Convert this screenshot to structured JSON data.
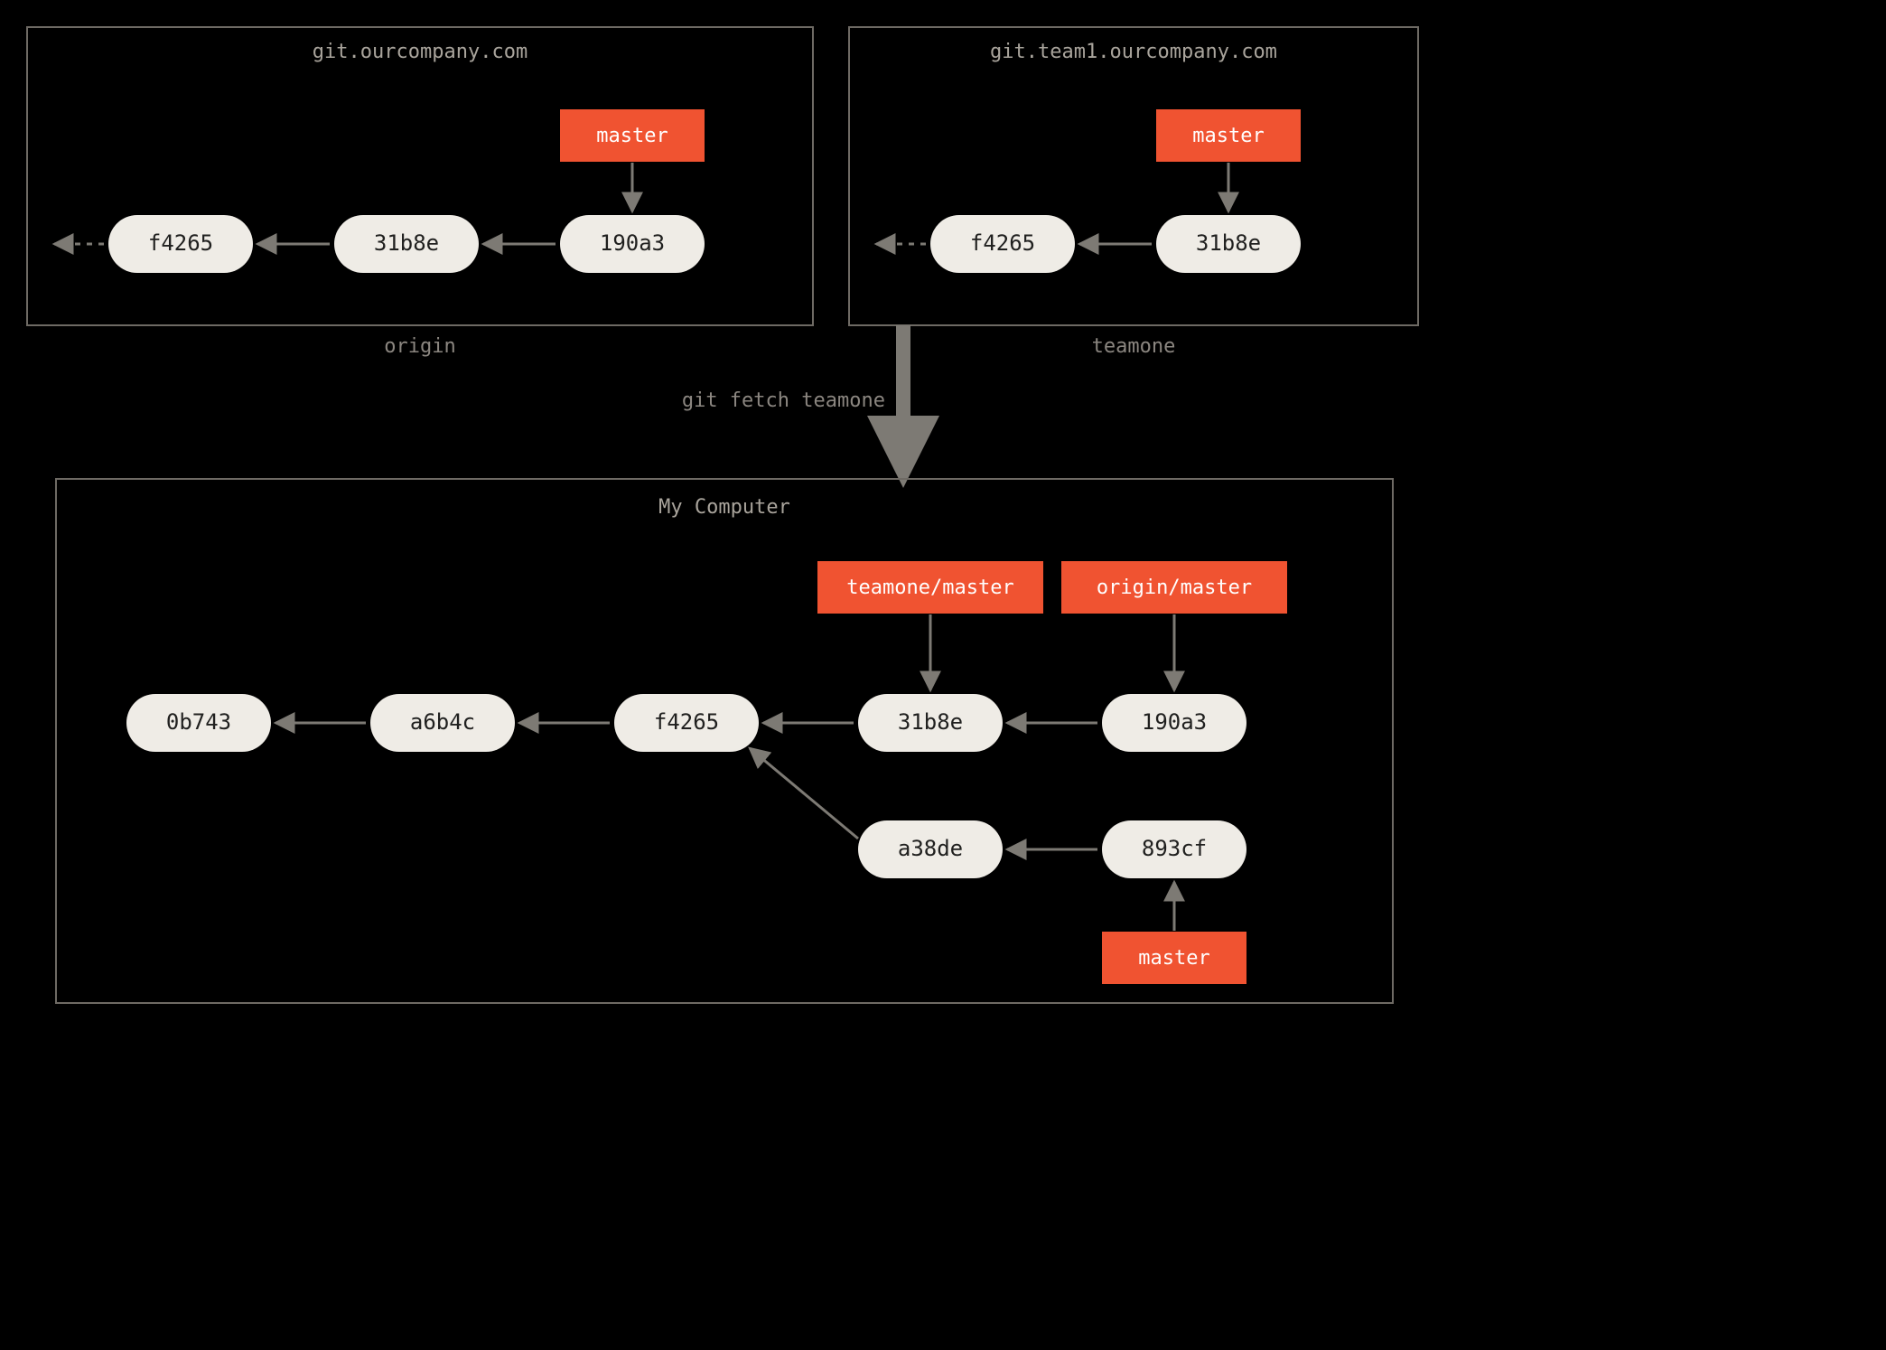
{
  "remotes": {
    "origin": {
      "host": "git.ourcompany.com",
      "label": "origin",
      "branch": "master",
      "commits": [
        "f4265",
        "31b8e",
        "190a3"
      ]
    },
    "teamone": {
      "host": "git.team1.ourcompany.com",
      "label": "teamone",
      "branch": "master",
      "commits": [
        "f4265",
        "31b8e"
      ]
    }
  },
  "fetch_command": "git fetch teamone",
  "local": {
    "title": "My Computer",
    "commits_main": [
      "0b743",
      "a6b4c",
      "f4265",
      "31b8e",
      "190a3"
    ],
    "commits_branch": [
      "a38de",
      "893cf"
    ],
    "refs": {
      "teamone_master": "teamone/master",
      "origin_master": "origin/master",
      "master": "master"
    }
  },
  "colors": {
    "bg": "#000000",
    "panel_stroke": "#6e6a64",
    "commit_fill": "#efece6",
    "commit_text": "#20201f",
    "ref_fill": "#f05331",
    "ref_text": "#ffffff",
    "muted_text": "#8b8680",
    "title_text": "#a9a49c",
    "arrow": "#7d7a74"
  }
}
